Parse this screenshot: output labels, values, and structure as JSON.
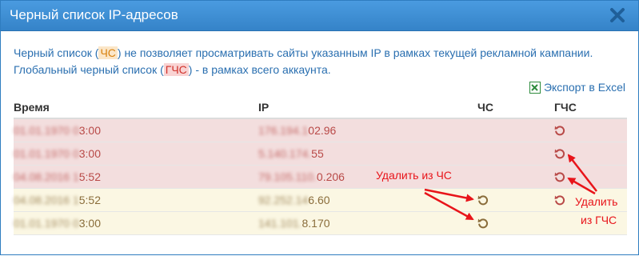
{
  "dialog": {
    "title": "Черный список IP-адресов",
    "close_icon": "close-icon"
  },
  "description": {
    "line1_pre": "Черный список (",
    "line1_abbr": "ЧС",
    "line1_post": ") не позволяет просматривать сайты указанным IP в рамках текущей рекламной кампании.",
    "line2_pre": "Глобальный черный список (",
    "line2_abbr": "ГЧС",
    "line2_post": ") - в рамках всего аккаунта."
  },
  "export": {
    "icon": "excel-icon",
    "label": "Экспорт в Excel"
  },
  "table": {
    "headers": {
      "time": "Время",
      "ip": "IP",
      "ch": "ЧС",
      "gch": "ГЧС"
    },
    "rows": [
      {
        "time_hidden": "01.01.1970 0",
        "time": "3:00",
        "ip_hidden": "176.194.1",
        "ip": "02.96",
        "status": "gch"
      },
      {
        "time_hidden": "01.01.1970 0",
        "time": "3:00",
        "ip_hidden": "5.140.174.",
        "ip": "55",
        "status": "gch"
      },
      {
        "time_hidden": "04.08.2016 1",
        "time": "5:52",
        "ip_hidden": "79.105.110.",
        "ip": "0.206",
        "status": "gch"
      },
      {
        "time_hidden": "04.08.2016 1",
        "time": "5:52",
        "ip_hidden": "92.252.14",
        "ip": "6.60",
        "status": "both"
      },
      {
        "time_hidden": "01.01.1970 0",
        "time": "3:00",
        "ip_hidden": "141.101.",
        "ip": "8.170",
        "status": "ch"
      }
    ]
  },
  "annotations": {
    "remove_ch": "Удалить из ЧС",
    "remove_gch_line1": "Удалить",
    "remove_gch_line2": "из ГЧС"
  },
  "colors": {
    "titlebar": "#3d8fd4",
    "red_row": "#f3dede",
    "yellow_row": "#fbf7e3",
    "annotation": "#e8141a"
  }
}
